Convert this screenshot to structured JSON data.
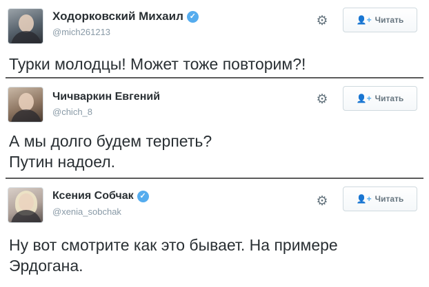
{
  "follow_label": "Читать",
  "icons": {
    "settings": "gear-icon",
    "follow": "add-user-icon",
    "verified": "verified-badge-icon"
  },
  "colors": {
    "verified": "#55acee",
    "handle": "#8899a6",
    "text": "#292f33",
    "follow_icon": "#55acee"
  },
  "tweets": [
    {
      "name": "Ходорковский Михаил",
      "verified": true,
      "handle": "@mich261213",
      "text_lines": [
        "Турки молодцы! Может тоже повторим?!"
      ]
    },
    {
      "name": "Чичваркин Евгений",
      "verified": false,
      "handle": "@chich_8",
      "text_lines": [
        "А мы долго будем терпеть?",
        "Путин надоел."
      ]
    },
    {
      "name": "Ксения Собчак",
      "verified": true,
      "handle": "@xenia_sobchak",
      "text_lines": [
        "Ну вот смотрите как это бывает. На примере",
        "Эрдогана."
      ]
    }
  ]
}
